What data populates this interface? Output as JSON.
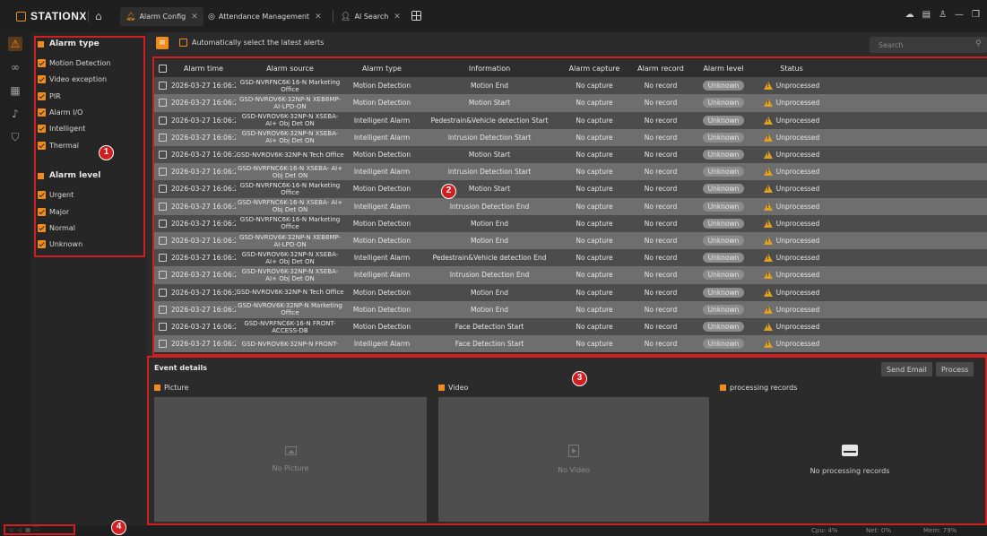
{
  "app": {
    "title": "STATIONX"
  },
  "tabs": [
    {
      "label": "Alarm Config",
      "active": true
    },
    {
      "label": "Attendance Management",
      "active": false
    },
    {
      "label": "AI Search",
      "active": false
    }
  ],
  "rail_icons": [
    "alarm-icon",
    "link-icon",
    "building-icon",
    "bell-icon",
    "shield-icon"
  ],
  "filter": {
    "alarm_type_title": "Alarm type",
    "alarm_types": [
      "Motion Detection",
      "Video exception",
      "PIR",
      "Alarm I/O",
      "Intelligent",
      "Thermal"
    ],
    "alarm_level_title": "Alarm level",
    "alarm_levels": [
      "Urgent",
      "Major",
      "Normal",
      "Unknown"
    ]
  },
  "toolbar": {
    "auto_select_label": "Automatically select the latest alerts",
    "search_placeholder": "Search"
  },
  "table": {
    "headers": {
      "time": "Alarm time",
      "source": "Alarm source",
      "type": "Alarm type",
      "info": "Information",
      "capture": "Alarm capture",
      "record": "Alarm record",
      "level": "Alarm level",
      "status": "Status"
    },
    "rows": [
      {
        "time": "2026-03-27 16:06:26",
        "source": "GSD-NVRFNC6K-16-N Marketing Office",
        "type": "Motion Detection",
        "info": "Motion End",
        "capture": "No capture",
        "record": "No record",
        "level": "Unknown",
        "status": "Unprocessed"
      },
      {
        "time": "2026-03-27 16:06:26",
        "source": "GSD-NVROV6K-32NP-N XEB8MP-AI-LPD-ON",
        "type": "Motion Detection",
        "info": "Motion Start",
        "capture": "No capture",
        "record": "No record",
        "level": "Unknown",
        "status": "Unprocessed"
      },
      {
        "time": "2026-03-27 16:06:26",
        "source": "GSD-NVROV6K-32NP-N XSEBA- AI+ Obj Det ON",
        "type": "Intelligent Alarm",
        "info": "Pedestrain&Vehicle detection Start",
        "capture": "No capture",
        "record": "No record",
        "level": "Unknown",
        "status": "Unprocessed"
      },
      {
        "time": "2026-03-27 16:06:26",
        "source": "GSD-NVROV6K-32NP-N XSEBA- AI+ Obj Det ON",
        "type": "Intelligent Alarm",
        "info": "Intrusion Detection Start",
        "capture": "No capture",
        "record": "No record",
        "level": "Unknown",
        "status": "Unprocessed"
      },
      {
        "time": "2026-03-27 16:06:26",
        "source": "GSD-NVROV6K-32NP-N Tech Office",
        "type": "Motion Detection",
        "info": "Motion Start",
        "capture": "No capture",
        "record": "No record",
        "level": "Unknown",
        "status": "Unprocessed"
      },
      {
        "time": "2026-03-27 16:06:25",
        "source": "GSD-NVRFNC6K-16-N XSEBA- AI+ Obj Det ON",
        "type": "Intelligent Alarm",
        "info": "Intrusion Detection Start",
        "capture": "No capture",
        "record": "No record",
        "level": "Unknown",
        "status": "Unprocessed"
      },
      {
        "time": "2026-03-27 16:06:25",
        "source": "GSD-NVRFNC6K-16-N Marketing Office",
        "type": "Motion Detection",
        "info": "Motion Start",
        "capture": "No capture",
        "record": "No record",
        "level": "Unknown",
        "status": "Unprocessed"
      },
      {
        "time": "2026-03-27 16:06:25",
        "source": "GSD-NVRFNC6K-16-N XSEBA- AI+ Obj Det ON",
        "type": "Intelligent Alarm",
        "info": "Intrusion Detection End",
        "capture": "No capture",
        "record": "No record",
        "level": "Unknown",
        "status": "Unprocessed"
      },
      {
        "time": "2026-03-27 16:06:25",
        "source": "GSD-NVRFNC6K-16-N Marketing Office",
        "type": "Motion Detection",
        "info": "Motion End",
        "capture": "No capture",
        "record": "No record",
        "level": "Unknown",
        "status": "Unprocessed"
      },
      {
        "time": "2026-03-27 16:06:25",
        "source": "GSD-NVROV6K-32NP-N XEB8MP-AI-LPD-ON",
        "type": "Motion Detection",
        "info": "Motion End",
        "capture": "No capture",
        "record": "No record",
        "level": "Unknown",
        "status": "Unprocessed"
      },
      {
        "time": "2026-03-27 16:06:25",
        "source": "GSD-NVROV6K-32NP-N XSEBA- AI+ Obj Det ON",
        "type": "Intelligent Alarm",
        "info": "Pedestrain&Vehicle detection End",
        "capture": "No capture",
        "record": "No record",
        "level": "Unknown",
        "status": "Unprocessed"
      },
      {
        "time": "2026-03-27 16:06:25",
        "source": "GSD-NVROV6K-32NP-N XSEBA- AI+ Obj Det ON",
        "type": "Intelligent Alarm",
        "info": "Intrusion Detection End",
        "capture": "No capture",
        "record": "No record",
        "level": "Unknown",
        "status": "Unprocessed"
      },
      {
        "time": "2026-03-27 16:06:25",
        "source": "GSD-NVROV6K-32NP-N Tech Office",
        "type": "Motion Detection",
        "info": "Motion End",
        "capture": "No capture",
        "record": "No record",
        "level": "Unknown",
        "status": "Unprocessed"
      },
      {
        "time": "2026-03-27 16:06:25",
        "source": "GSD-NVROV6K-32NP-N Marketing Office",
        "type": "Motion Detection",
        "info": "Motion End",
        "capture": "No capture",
        "record": "No record",
        "level": "Unknown",
        "status": "Unprocessed"
      },
      {
        "time": "2026-03-27 16:06:20",
        "source": "GSD-NVRFNC6K-16-N FRONT-ACCESS-DB",
        "type": "Motion Detection",
        "info": "Face Detection Start",
        "capture": "No capture",
        "record": "No record",
        "level": "Unknown",
        "status": "Unprocessed"
      },
      {
        "time": "2026-03-27 16:06:20",
        "source": "GSD-NVROV6K-32NP-N FRONT-",
        "type": "Intelligent Alarm",
        "info": "Face Detection Start",
        "capture": "No capture",
        "record": "No record",
        "level": "Unknown",
        "status": "Unprocessed"
      }
    ]
  },
  "details": {
    "title": "Event details",
    "send_email": "Send Email",
    "process": "Process",
    "picture_title": "Picture",
    "picture_empty": "No Picture",
    "video_title": "Video",
    "video_empty": "No Video",
    "records_title": "processing records",
    "records_empty": "No processing records"
  },
  "statusbar": {
    "cpu": "Cpu: 4%",
    "net": "Net: 0%",
    "mem": "Mem: 79%"
  },
  "callouts": [
    "1",
    "2",
    "3",
    "4"
  ],
  "colors": {
    "accent": "#f08c1e",
    "highlight": "#d11e1e",
    "warning": "#e0a020"
  }
}
